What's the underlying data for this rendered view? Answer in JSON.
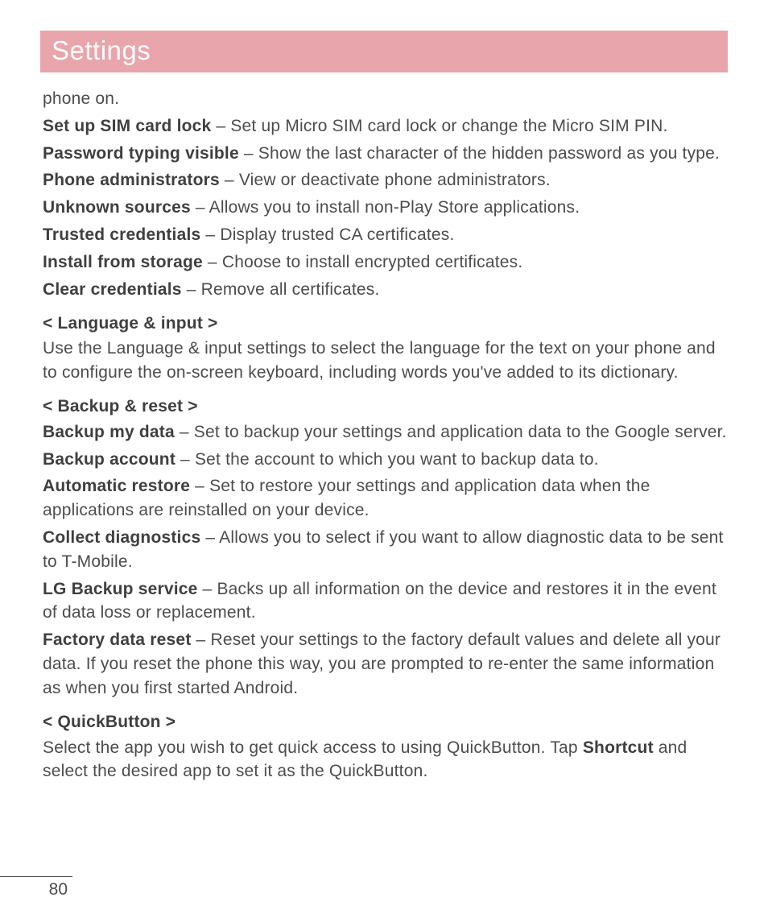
{
  "title": "Settings",
  "page_number": "80",
  "intro_fragment": "phone on.",
  "security_items": [
    {
      "label": "Set up SIM card lock",
      "desc": " – Set up Micro SIM card lock or change the Micro SIM PIN."
    },
    {
      "label": "Password typing visible",
      "desc": " – Show the last character of the hidden password as you type."
    },
    {
      "label": "Phone administrators",
      "desc": " – View or deactivate phone administrators."
    },
    {
      "label": "Unknown sources",
      "desc": " – Allows you to install non-Play Store applications."
    },
    {
      "label": "Trusted credentials",
      "desc": " – Display trusted CA certificates."
    },
    {
      "label": "Install from storage",
      "desc": " – Choose to install encrypted certificates."
    },
    {
      "label": "Clear credentials",
      "desc": " – Remove all certificates."
    }
  ],
  "language_section": {
    "heading": "< Language & input >",
    "desc": "Use the Language & input settings to select the language for the text on your phone and to configure the on-screen keyboard, including words you've added to its dictionary."
  },
  "backup_section": {
    "heading": "< Backup & reset >",
    "items": [
      {
        "label": "Backup my data",
        "desc": " – Set to backup your settings and application data to the Google server."
      },
      {
        "label": "Backup account",
        "desc": " – Set the account to which you want to backup data to."
      },
      {
        "label": "Automatic restore",
        "desc": " – Set to restore your settings and application data when the applications are reinstalled on your device."
      },
      {
        "label": "Collect diagnostics",
        "desc": " – Allows you to select if you want to allow diagnostic data to be sent to T-Mobile."
      },
      {
        "label": "LG Backup service",
        "desc": " – Backs up all information on the device and restores it in the event of data loss or replacement."
      },
      {
        "label": "Factory data reset",
        "desc": " – Reset your settings to the factory default values and delete all your data. If you reset the phone this way, you are prompted to re-enter the same information as when you first started Android."
      }
    ]
  },
  "quickbutton_section": {
    "heading": "< QuickButton >",
    "line1_pre": "Select the app you wish to get quick access to using QuickButton. Tap ",
    "bold": "Shortcut",
    "line1_post": " and select the desired app to set it as the QuickButton."
  }
}
